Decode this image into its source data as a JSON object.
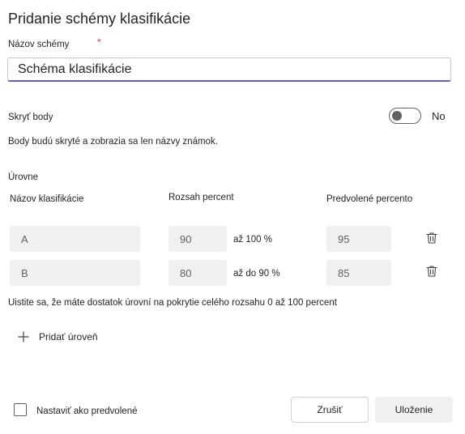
{
  "dialog": {
    "title": "Pridanie schémy klasifikácie"
  },
  "scheme_name": {
    "label": "Názov schémy",
    "required_mark": "*",
    "value": "Schéma klasifikácie"
  },
  "hide_points": {
    "label": "Skryť body",
    "state_text": "No",
    "enabled": false,
    "description": "Body budú skryté a zobrazia sa len názvy známok."
  },
  "levels": {
    "section_label": "Úrovne",
    "headers": {
      "name": "Názov klasifikácie",
      "range": "Rozsah percent",
      "default": "Predvolené percento"
    },
    "rows": [
      {
        "name": "A",
        "range_value": "90",
        "range_text": "až 100 %",
        "default_percent": "95"
      },
      {
        "name": "B",
        "range_value": "80",
        "range_text": "až do 90 %",
        "default_percent": "85"
      }
    ],
    "coverage_note": "Uistite sa, že máte dostatok úrovní na pokrytie celého rozsahu 0 až 100 percent",
    "add_label": "Pridať úroveň"
  },
  "footer": {
    "set_default_label": "Nastaviť ako predvolené",
    "cancel_label": "Zrušiť",
    "save_label": "Uloženie"
  },
  "colors": {
    "accent": "#5b5fc7",
    "required": "#c4314b",
    "field_bg": "#f0f0f0"
  }
}
